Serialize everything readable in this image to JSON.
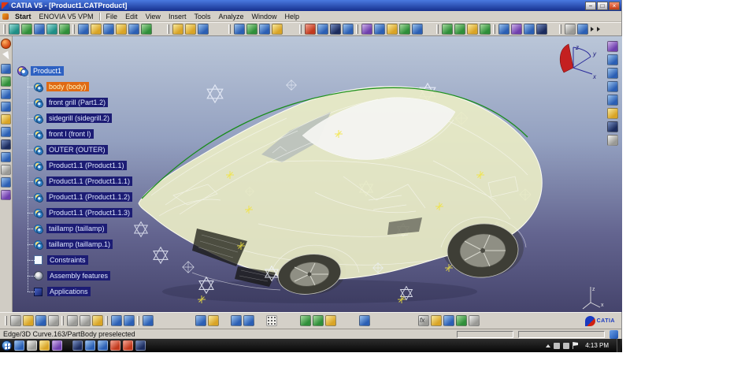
{
  "window": {
    "title": "CATIA V5 - [Product1.CATProduct]"
  },
  "menu": {
    "items": [
      "Start",
      "ENOVIA V5 VPM",
      "File",
      "Edit",
      "View",
      "Insert",
      "Tools",
      "Analyze",
      "Window",
      "Help"
    ]
  },
  "tree": {
    "items": [
      {
        "label": "Product1",
        "state": "selected"
      },
      {
        "label": "body (body)",
        "state": "preselected"
      },
      {
        "label": "front grill (Part1.2)",
        "state": "highlighted"
      },
      {
        "label": "sidegrill (sidegrill.2)",
        "state": "highlighted"
      },
      {
        "label": "front l (front l)",
        "state": "highlighted"
      },
      {
        "label": "OUTER (OUTER)",
        "state": "highlighted"
      },
      {
        "label": "Product1.1 (Product1.1)",
        "state": "highlighted"
      },
      {
        "label": "Product1.1 (Product1.1.1)",
        "state": "highlighted"
      },
      {
        "label": "Product1.1 (Product1.1.2)",
        "state": "highlighted"
      },
      {
        "label": "Product1.1 (Product1.1.3)",
        "state": "highlighted"
      },
      {
        "label": "taillamp (taillamp)",
        "state": "highlighted"
      },
      {
        "label": "taillamp (taillamp.1)",
        "state": "highlighted"
      },
      {
        "label": "Constraints",
        "state": "highlighted"
      },
      {
        "label": "Assembly features",
        "state": "highlighted"
      },
      {
        "label": "Applications",
        "state": "highlighted"
      }
    ]
  },
  "viewport": {
    "compass": {
      "x": "x",
      "y": "y",
      "z": "z"
    }
  },
  "toolbars": {
    "top": [
      "vpm-new-icon",
      "vpm-open-icon",
      "vpm-save-icon",
      "vpm-search-icon",
      "vpm-refresh-icon",
      "new-component-icon",
      "new-product-icon",
      "new-part-icon",
      "existing-component-icon",
      "replace-component-icon",
      "graph-tree-icon",
      "paste-special-icon",
      "fast-instantiation-icon",
      "multi-instantiation-icon",
      "smart-move-icon",
      "manipulate-icon",
      "snap-icon",
      "explode-icon",
      "clash-icon",
      "sectioning-icon",
      "distance-icon",
      "measure-between-icon",
      "measure-item-icon",
      "measure-inertia-icon",
      "coincidence-constraint-icon",
      "contact-constraint-icon",
      "offset-constraint-icon",
      "angle-constraint-icon",
      "fix-constraint-icon",
      "fix-together-icon",
      "quick-constraint-icon",
      "flexible-rigid-icon",
      "change-constraint-icon",
      "reuse-pattern-icon",
      "update-all-icon",
      "catalog-icon",
      "annotations-icon",
      "toolbar-overflow-chevron"
    ],
    "left": [
      "assembly-workbench-icon",
      "select-arrow-icon",
      "pan-icon",
      "rotate-icon",
      "zoom-in-icon",
      "zoom-out-icon",
      "fit-all-icon",
      "normal-view-icon",
      "hide-show-icon",
      "swap-visible-icon",
      "wireframe-view-icon",
      "shading-view-icon",
      "compass-tool-icon"
    ],
    "right": [
      "tree-graph-icon",
      "isometric-view-icon",
      "front-view-icon",
      "top-view-icon",
      "left-view-icon",
      "named-views-icon",
      "render-style-icon",
      "full-screen-icon"
    ],
    "bottom": [
      "new-document-icon",
      "open-icon",
      "save-icon",
      "print-icon",
      "cut-icon",
      "copy-icon",
      "paste-icon",
      "undo-icon",
      "redo-icon",
      "help-icon",
      "hyperlink-icon",
      "web-icon",
      "knowledge-template-icon",
      "design-table-icon",
      "grid-icon",
      "measure-between-icon",
      "measure-item-icon",
      "measure-inertia-icon",
      "isometric-cube-icon",
      "formula-fx-icon",
      "annotation-icon",
      "rules-icon",
      "checks-icon",
      "settings-icon",
      "catia-logo"
    ]
  },
  "status": {
    "message": "Edge/3D Curve.163/PartBody preselected"
  },
  "taskbar": {
    "clock": "4:13 PM",
    "start": "start-button",
    "quick_launch": [
      "pinned-app-1",
      "pinned-app-2",
      "windows-explorer-icon",
      "media-player-icon",
      "pinned-app-5",
      "internet-explorer-icon",
      "word-icon",
      "acrobat-icon",
      "mail-icon",
      "pinned-app-10"
    ],
    "tray": [
      "hidden-icons-arrow",
      "network-icon",
      "volume-icon",
      "action-center-icon"
    ]
  },
  "logo": {
    "text": "CATIA"
  },
  "colors": {
    "selection_blue": "#2e61c2",
    "preselect_orange": "#e06a14",
    "tree_navy": "#1c1c74",
    "viewport_top": "#bac6d8",
    "viewport_bottom": "#45446c",
    "toolbar_gray": "#d4d0c8",
    "car_body": "#e9ebc6",
    "spline_green": "#138a13"
  }
}
